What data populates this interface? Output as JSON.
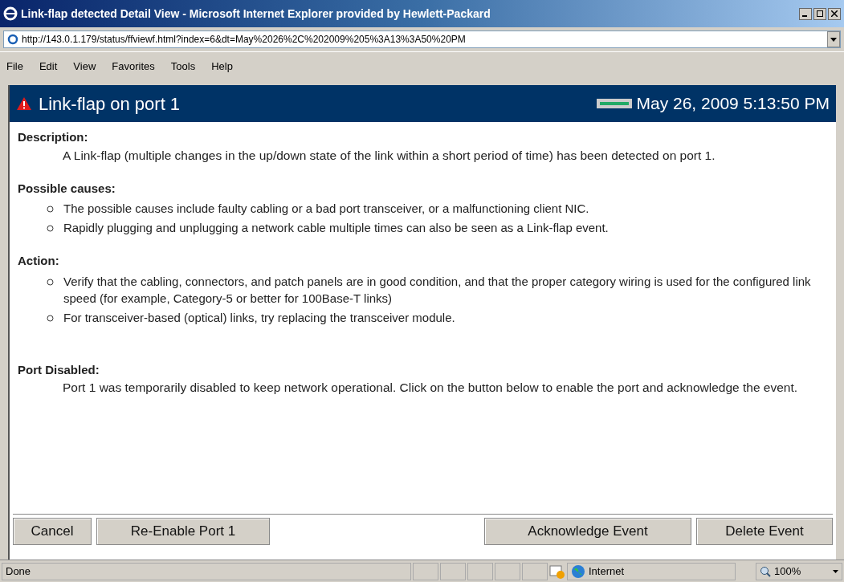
{
  "window": {
    "title": "Link-flap detected Detail View - Microsoft Internet Explorer provided by Hewlett-Packard"
  },
  "address": "http://143.0.1.179/status/ffviewf.html?index=6&dt=May%2026%2C%202009%205%3A13%3A50%20PM",
  "menu": [
    "File",
    "Edit",
    "View",
    "Favorites",
    "Tools",
    "Help"
  ],
  "header": {
    "title": "Link-flap on port 1",
    "timestamp": "May 26, 2009 5:13:50 PM"
  },
  "sections": [
    {
      "heading": "Description:",
      "kind": "paragraph",
      "text": "A Link-flap (multiple changes in the up/down state of the link within a short period of time) has been detected on port 1."
    },
    {
      "heading": "Possible causes:",
      "kind": "list",
      "items": [
        "The possible causes include faulty cabling or a bad port transceiver, or a malfunctioning client NIC.",
        "Rapidly plugging and unplugging a network cable multiple times can also be seen as a Link-flap event."
      ]
    },
    {
      "heading": "Action:",
      "kind": "list",
      "items": [
        "Verify that the cabling, connectors, and patch panels are in good condition, and that the proper category wiring is used for the configured link speed (for example, Category-5 or better for 100Base-T links)",
        "For transceiver-based (optical) links, try replacing the transceiver module."
      ]
    },
    {
      "heading": "Port Disabled:",
      "kind": "paragraph",
      "text": "Port 1 was temporarily disabled to keep network operational. Click on the button below to enable the port and acknowledge the event."
    }
  ],
  "buttons_left": [
    "Cancel",
    "Re-Enable Port 1"
  ],
  "buttons_right": [
    "Acknowledge Event",
    "Delete Event"
  ],
  "status_bar": {
    "status": "Done",
    "zone": "Internet",
    "zoom": "100%"
  }
}
